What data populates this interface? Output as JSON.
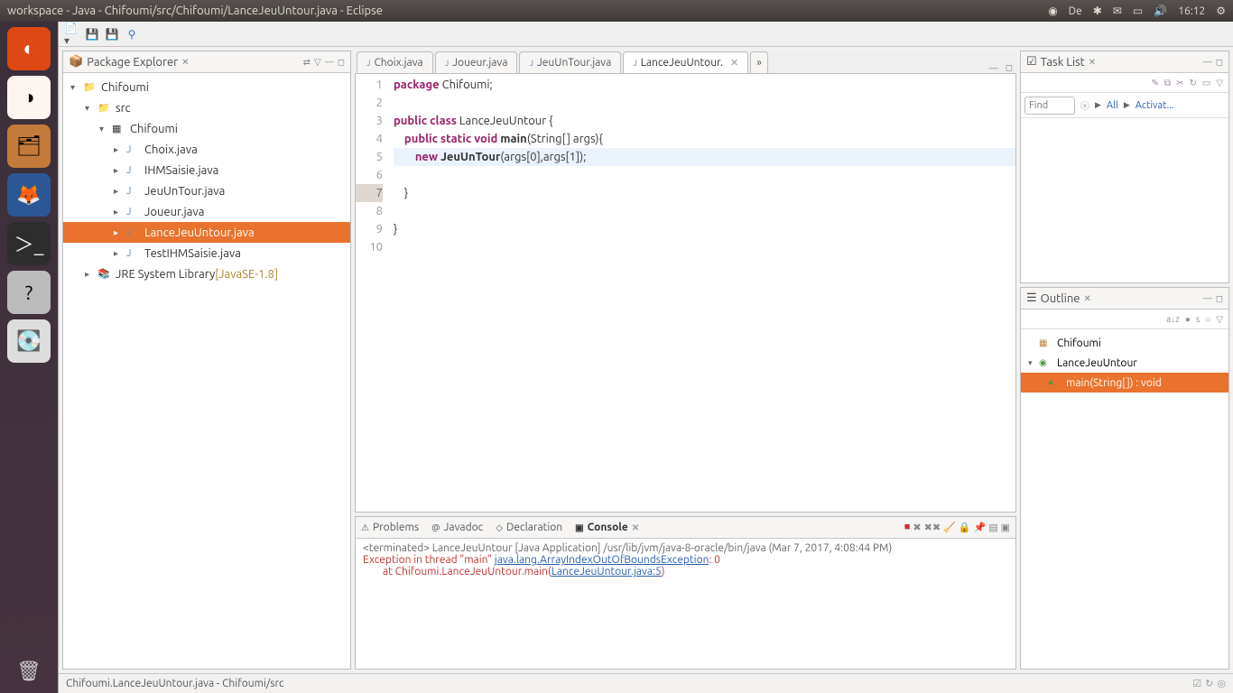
{
  "titlebar": {
    "title": "workspace - Java - Chifoumi/src/Chifoumi/LanceJeuUntour.java - Eclipse",
    "tray": {
      "lang": "De",
      "time": "16:12"
    }
  },
  "packageExplorer": {
    "title": "Package Explorer",
    "tree": {
      "project": "Chifoumi",
      "src": "src",
      "pkg": "Chifoumi",
      "files": [
        "Choix.java",
        "IHMSaisie.java",
        "JeuUnTour.java",
        "Joueur.java",
        "LanceJeuUntour.java",
        "TestIHMSaisie.java"
      ],
      "selected_index": 4,
      "lib_label": "JRE System Library",
      "lib_version": "[JavaSE-1.8]"
    }
  },
  "editor": {
    "tabs": [
      "Choix.java",
      "Joueur.java",
      "JeuUnTour.java",
      "LanceJeuUntour."
    ],
    "active_tab": 3,
    "lines": [
      {
        "n": 1,
        "tokens": [
          [
            "kw",
            "package"
          ],
          [
            "p",
            " Chifoumi;"
          ]
        ]
      },
      {
        "n": 2,
        "tokens": []
      },
      {
        "n": 3,
        "tokens": [
          [
            "kw",
            "public"
          ],
          [
            "p",
            " "
          ],
          [
            "kw",
            "class"
          ],
          [
            "p",
            " LanceJeuUntour {"
          ]
        ]
      },
      {
        "n": 4,
        "tokens": [
          [
            "p",
            "    "
          ],
          [
            "kw",
            "public"
          ],
          [
            "p",
            " "
          ],
          [
            "kw",
            "static"
          ],
          [
            "p",
            " "
          ],
          [
            "kw",
            "void"
          ],
          [
            "p",
            " "
          ],
          [
            "fn",
            "main"
          ],
          [
            "p",
            "(String[] args){"
          ]
        ]
      },
      {
        "n": 5,
        "hl": true,
        "tokens": [
          [
            "p",
            "        "
          ],
          [
            "kw",
            "new"
          ],
          [
            "p",
            " "
          ],
          [
            "fn",
            "JeuUnTour"
          ],
          [
            "p",
            "(args[0],args[1]);"
          ]
        ]
      },
      {
        "n": 6,
        "tokens": []
      },
      {
        "n": 7,
        "gutter_hl": true,
        "tokens": [
          [
            "p",
            "    }"
          ]
        ]
      },
      {
        "n": 8,
        "tokens": []
      },
      {
        "n": 9,
        "tokens": [
          [
            "p",
            "}"
          ]
        ]
      },
      {
        "n": 10,
        "tokens": []
      }
    ]
  },
  "console": {
    "tabs": [
      "Problems",
      "Javadoc",
      "Declaration",
      "Console"
    ],
    "active_tab": 3,
    "header": "<terminated> LanceJeuUntour [Java Application] /usr/lib/jvm/java-8-oracle/bin/java (Mar 7, 2017, 4:08:44 PM)",
    "lines": [
      {
        "parts": [
          [
            "err",
            "Exception in thread \"main\" "
          ],
          [
            "link",
            "java.lang.ArrayIndexOutOfBoundsException"
          ],
          [
            "err",
            ": 0"
          ]
        ]
      },
      {
        "parts": [
          [
            "err",
            "        at Chifoumi.LanceJeuUntour.main("
          ],
          [
            "link",
            "LanceJeuUntour.java:5"
          ],
          [
            "err",
            ")"
          ]
        ]
      }
    ]
  },
  "tasklist": {
    "title": "Task List",
    "find_placeholder": "Find",
    "all_label": "All",
    "activate_label": "Activat..."
  },
  "outline": {
    "title": "Outline",
    "pkg": "Chifoumi",
    "cls": "LanceJeuUntour",
    "method": "main(String[]) : void"
  },
  "statusbar": {
    "text": "Chifoumi.LanceJeuUntour.java - Chifoumi/src"
  }
}
